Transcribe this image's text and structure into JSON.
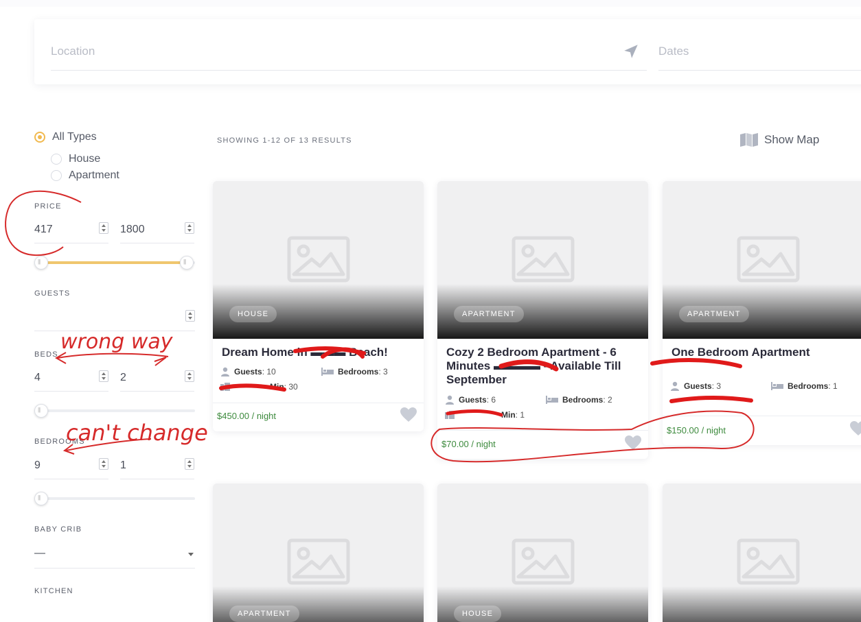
{
  "search": {
    "location_placeholder": "Location",
    "dates_placeholder": "Dates"
  },
  "filters": {
    "types": [
      {
        "label": "All Types",
        "selected": true
      },
      {
        "label": "House",
        "selected": false
      },
      {
        "label": "Apartment",
        "selected": false
      }
    ],
    "price": {
      "label": "PRICE",
      "min": "417",
      "max": "1800"
    },
    "guests": {
      "label": "GUESTS",
      "value": ""
    },
    "beds": {
      "label": "BEDS",
      "min": "4",
      "max": "2"
    },
    "bedrooms": {
      "label": "BEDROOMS",
      "min": "9",
      "max": "1"
    },
    "baby_crib": {
      "label": "BABY CRIB",
      "value": "—"
    },
    "kitchen": {
      "label": "KITCHEN"
    }
  },
  "results": {
    "showing": "SHOWING 1-12 OF 13 RESULTS",
    "show_map": "Show Map"
  },
  "listings": [
    {
      "type": "HOUSE",
      "title": "Dream Home in ▬▬▬ Beach!",
      "guests": "10",
      "bedrooms": "3",
      "min_label": "Min",
      "min_value": "30",
      "price": "$450.00 / night"
    },
    {
      "type": "APARTMENT",
      "title": "Cozy 2 Bedroom Apartment - 6 Minutes ▬▬▬▬ - Available Till September",
      "guests": "6",
      "bedrooms": "2",
      "min_label": "Min",
      "min_value": "1",
      "price": "$70.00 / night"
    },
    {
      "type": "APARTMENT",
      "title": "One Bedroom Apartment",
      "guests": "3",
      "bedrooms": "1",
      "min_label": "",
      "min_value": "",
      "price": "$150.00 / night"
    },
    {
      "type": "APARTMENT"
    },
    {
      "type": "HOUSE"
    },
    {
      "type": ""
    }
  ],
  "labels": {
    "guests": "Guests",
    "bedrooms": "Bedrooms"
  },
  "annotations": {
    "wrong_way": "wrong way",
    "cant_change": "can't change"
  },
  "colors": {
    "accent": "#f1b94f",
    "price": "#3d8a3d",
    "annotation": "#d62a2a"
  }
}
